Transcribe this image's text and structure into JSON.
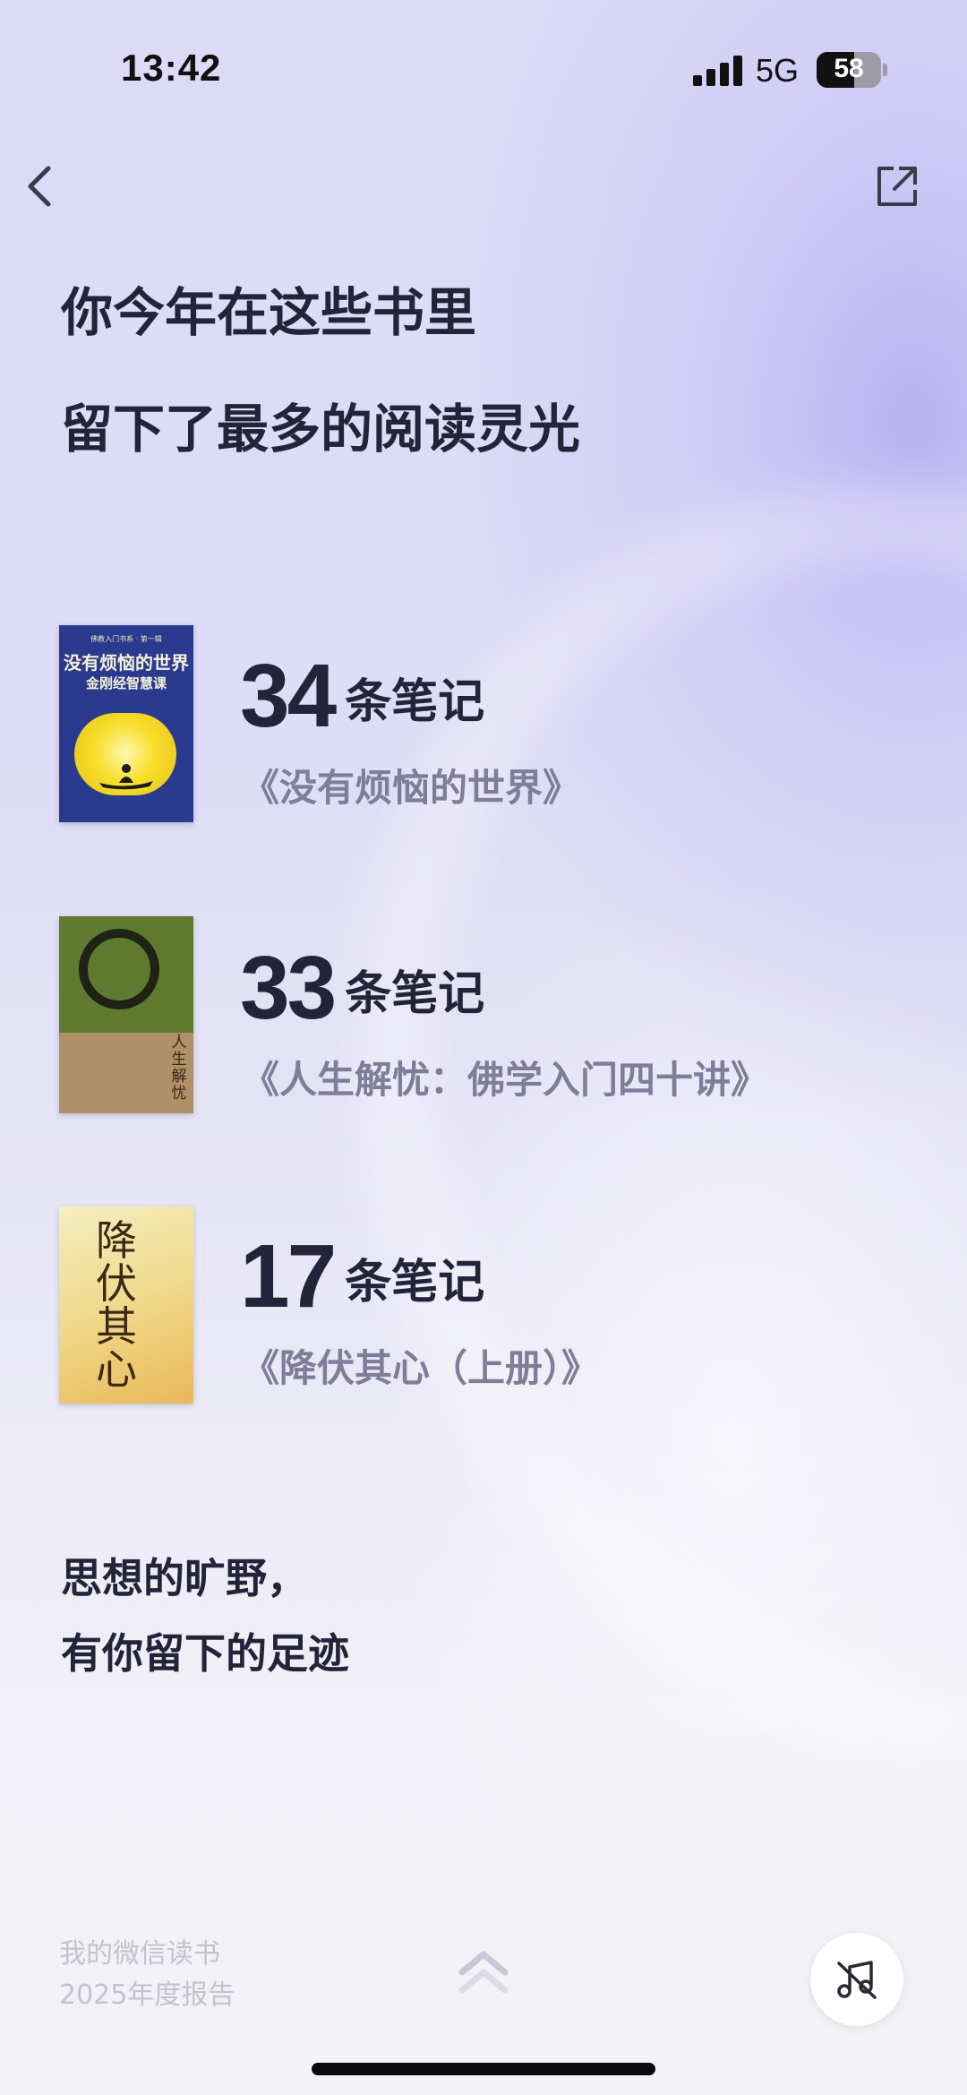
{
  "status_bar": {
    "time": "13:42",
    "network": "5G",
    "battery": "58"
  },
  "nav": {
    "back_icon": "chevron-left-icon",
    "share_icon": "share-external-icon"
  },
  "headline": {
    "line1": "你今年在这些书里",
    "line2": "留下了最多的阅读灵光"
  },
  "books": [
    {
      "count": "34",
      "unit": "条笔记",
      "title": "《没有烦恼的世界》",
      "cover": {
        "top_text": "佛教入门书系 · 第一辑",
        "title": "没有烦恼的世界",
        "subtitle": "金刚经智慧课",
        "colors": {
          "background": "#2a3a8e",
          "sun": "#f8de2a"
        }
      }
    },
    {
      "count": "33",
      "unit": "条笔记",
      "title": "《人生解忧：佛学入门四十讲》",
      "cover": {
        "side_text": "人生解忧",
        "colors": {
          "top": "#5f7a2e",
          "bottom": "#b09068",
          "ring": "#1d2416"
        }
      }
    },
    {
      "count": "17",
      "unit": "条笔记",
      "title": "《降伏其心（上册）》",
      "cover": {
        "title_vertical": "降伏其心",
        "colors": {
          "background": "#f0dc90"
        }
      }
    }
  ],
  "footer": {
    "slogan_line1": "思想的旷野，",
    "slogan_line2": "有你留下的足迹",
    "report_line1": "我的微信读书",
    "report_line2": "2025年度报告",
    "up_icon": "double-chevron-up-icon",
    "music_icon": "music-off-icon"
  },
  "colors": {
    "heading": "#23243a",
    "book_title": "#7f7d98",
    "muted": "#c3c2d0",
    "background": "#dedcf6"
  }
}
